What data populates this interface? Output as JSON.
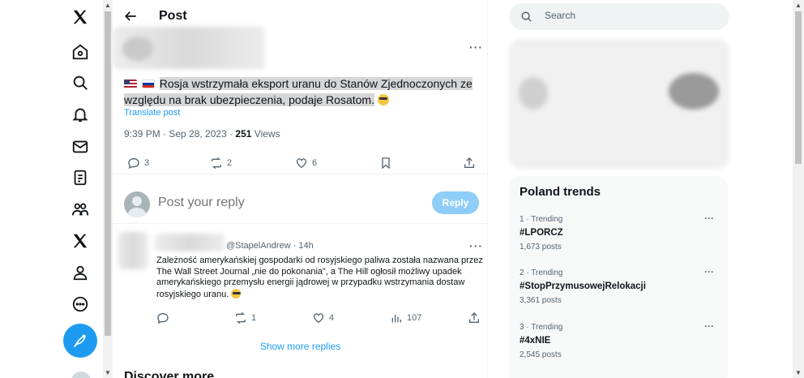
{
  "nav": {
    "icons": [
      "x-logo-icon",
      "home-icon",
      "explore-icon",
      "notifications-icon",
      "messages-icon",
      "lists-icon",
      "communities-icon",
      "premium-icon",
      "profile-icon",
      "more-icon"
    ]
  },
  "header": {
    "title": "Post"
  },
  "post": {
    "text_prefix": "",
    "text": "Rosja wstrzymała eksport uranu do Stanów Zjednoczonych ze względu na brak ubezpieczenia, podaje Rosatom.",
    "translate_label": "Translate post",
    "time": "9:39 PM · Sep 28, 2023 · ",
    "views_count": "251",
    "views_label": " Views",
    "replies": "3",
    "reposts": "2",
    "likes": "6"
  },
  "reply_box": {
    "placeholder": "Post your reply",
    "button_label": "Reply"
  },
  "comment": {
    "handle": "@StapelAndrew · 14h",
    "text": "Zależność amerykańskiej gospodarki od rosyjskiego paliwa została nazwana przez The Wall Street Journal „nie do pokonania”, a The Hill ogłosił możliwy upadek amerykańskiego przemysłu energii jądrowej w przypadku wstrzymania dostaw rosyjskiego uranu.",
    "replies": "",
    "reposts": "1",
    "likes": "4",
    "views": "107"
  },
  "show_more_label": "Show more replies",
  "discover_label": "Discover more",
  "search": {
    "placeholder": "Search"
  },
  "trends": {
    "title": "Poland trends",
    "items": [
      {
        "meta": "1 · Trending",
        "name": "#LPORCZ",
        "count": "1,673 posts"
      },
      {
        "meta": "2 · Trending",
        "name": "#StopPrzymusowejRelokacji",
        "count": "3,361 posts"
      },
      {
        "meta": "3 · Trending",
        "name": "#4xNIE",
        "count": "2,545 posts"
      }
    ]
  },
  "colors": {
    "accent": "#1d9bf0",
    "reply_button": "#8ecdf8",
    "text": "#0f1419",
    "muted": "#536471"
  }
}
